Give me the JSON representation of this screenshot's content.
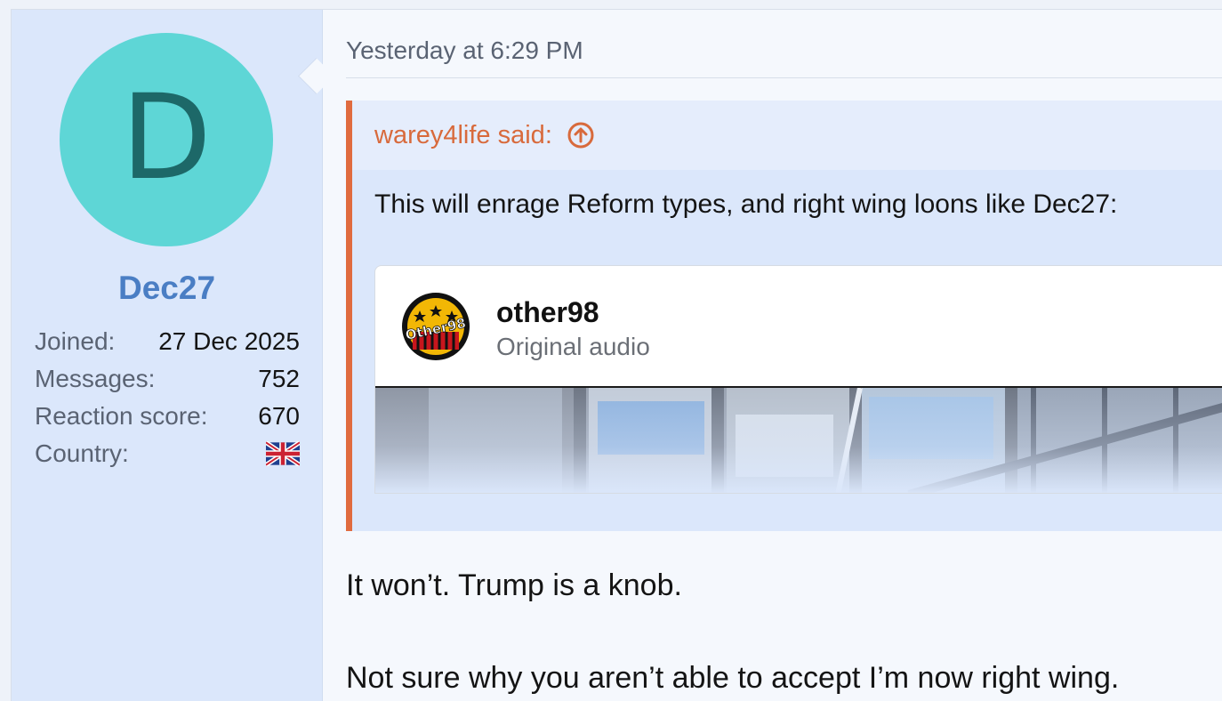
{
  "user": {
    "avatar_letter": "D",
    "avatar_color": "#5ed6d6",
    "username": "Dec27",
    "stats": [
      {
        "label": "Joined:",
        "value": "27 Dec 2025"
      },
      {
        "label": "Messages:",
        "value": "752"
      },
      {
        "label": "Reaction score:",
        "value": "670"
      }
    ],
    "country_label": "Country:",
    "country_flag_icon": "uk-flag-icon"
  },
  "post": {
    "timestamp": "Yesterday at 6:29 PM",
    "quote": {
      "author_said": "warey4life said:",
      "jump_icon": "arrow-up-circle-icon",
      "text": "This will enrage Reform types, and right wing loons like Dec27:",
      "accent_color": "#e06b3f",
      "embed": {
        "account": "other98",
        "subtitle": "Original audio",
        "logo_text": "Other98"
      }
    },
    "reply_lines": [
      "It won’t. Trump is a knob.",
      "Not sure why you aren’t able to accept I’m now right wing."
    ]
  }
}
